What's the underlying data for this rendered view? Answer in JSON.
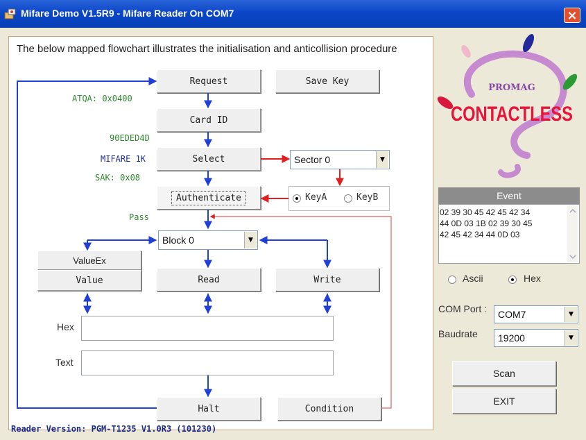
{
  "window": {
    "title": "Mifare Demo V1.5R9 - Mifare Reader On COM7",
    "close_glyph": "×"
  },
  "flowchart": {
    "description": "The below mapped flowchart illustrates the initialisation and anticollision procedure",
    "buttons": {
      "request": "Request",
      "save_key": "Save Key",
      "card_id": "Card ID",
      "select": "Select",
      "authenticate": "Authenticate",
      "value_ex": "ValueEx",
      "value": "Value",
      "read": "Read",
      "write": "Write",
      "halt": "Halt",
      "condition": "Condition"
    },
    "labels": {
      "atqa": "ATQA: 0x0400",
      "card_id_value": "90EDED4D",
      "card_type": "MIFARE 1K",
      "sak": "SAK: 0x08",
      "auth_result": "Pass"
    },
    "sector_select": {
      "selected": "Sector 0"
    },
    "block_select": {
      "selected": "Block 0"
    },
    "key_type": {
      "key_a": "KeyA",
      "key_b": "KeyB",
      "selected": "KeyA"
    },
    "hex_label": "Hex",
    "text_label": "Text",
    "hex_value": "",
    "text_value": ""
  },
  "logo": {
    "brand": "PROMAG",
    "word": "CONTACTLESS"
  },
  "event": {
    "title": "Event",
    "log": "02 39 30 45 42 45 42 34\n44 0D 03 1B 02 39 30 45\n42 45 42 34 44 0D 03"
  },
  "display_mode": {
    "ascii": "Ascii",
    "hex": "Hex",
    "selected": "Hex"
  },
  "com": {
    "port_label": "COM Port :",
    "port_value": "COM7",
    "baud_label": "Baudrate",
    "baud_value": "19200"
  },
  "actions": {
    "scan": "Scan",
    "exit": "EXIT"
  },
  "status": {
    "reader_version": "Reader Version: PGM-T1235 V1.0R3 (101230)"
  },
  "colors": {
    "titlebar": "#0a46c8",
    "flow_arrow": "#1f3fd6",
    "auth_arrow": "#e02020",
    "ok_text": "#2e8b2e",
    "info_text": "#1c2c8c"
  }
}
